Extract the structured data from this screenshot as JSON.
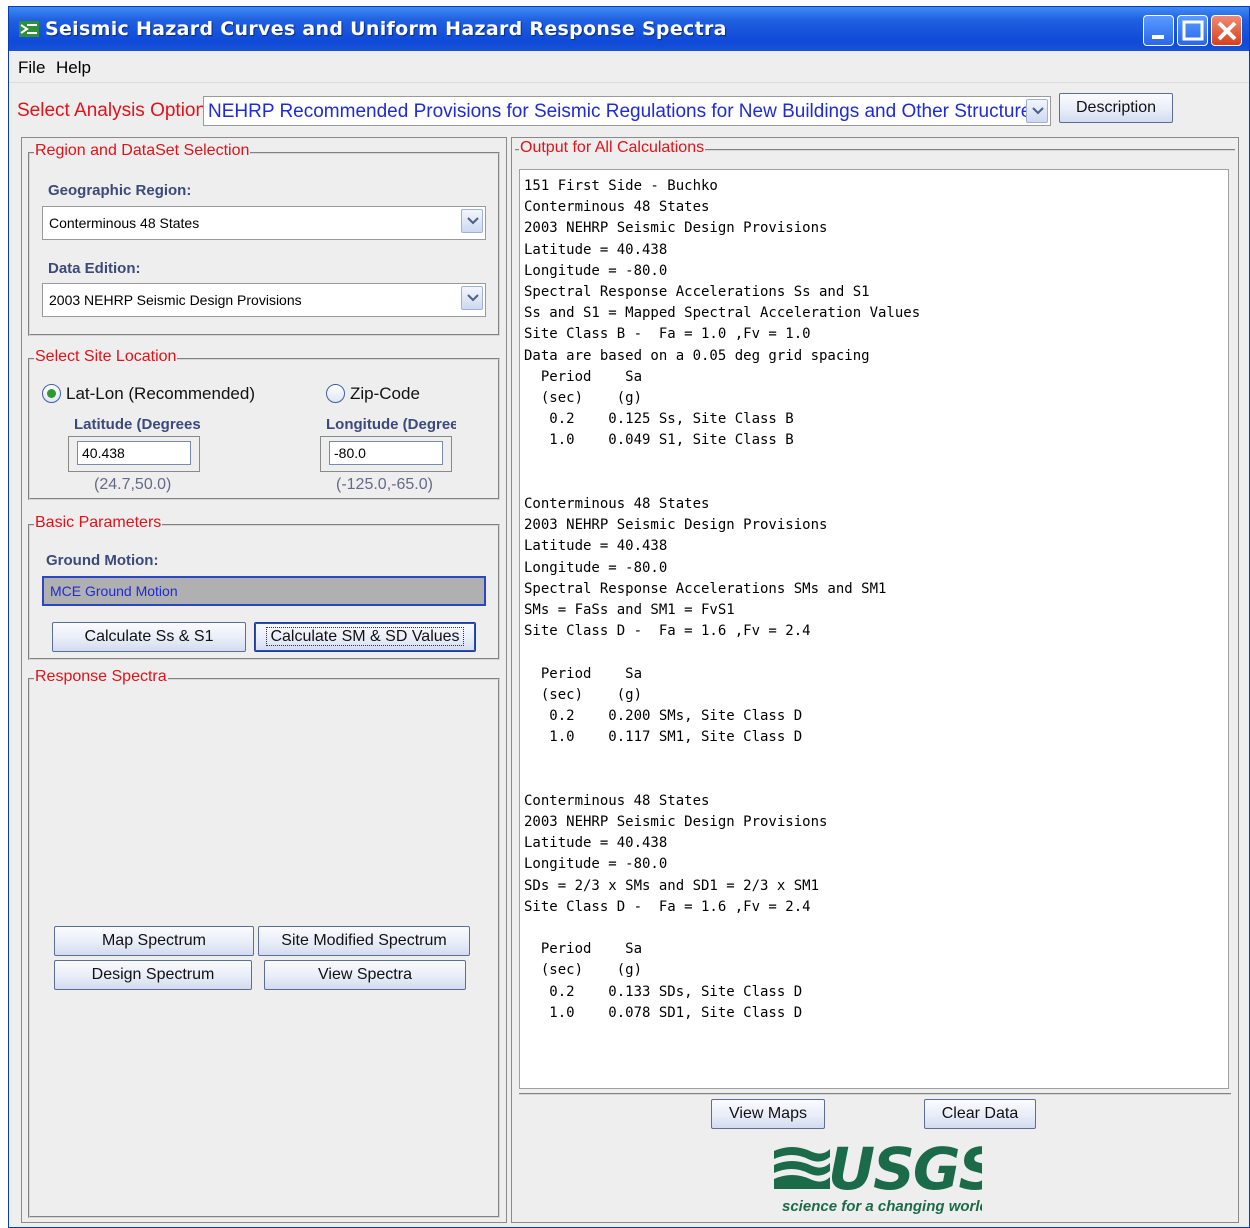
{
  "window": {
    "title": "Seismic Hazard Curves and Uniform Hazard Response Spectra",
    "accent": "#1f5fe0"
  },
  "menu": {
    "file": "File",
    "help": "Help"
  },
  "analysis": {
    "label": "Select Analysis Option:",
    "selected": "NEHRP Recommended Provisions for Seismic Regulations for New Buildings and Other Structures",
    "description_button": "Description"
  },
  "region": {
    "legend": "Region and DataSet Selection",
    "geo_label": "Geographic Region:",
    "geo_value": "Conterminous 48 States",
    "edition_label": "Data Edition:",
    "edition_value": "2003 NEHRP Seismic Design Provisions"
  },
  "site": {
    "legend": "Select Site Location",
    "latlon_label": "Lat-Lon (Recommended)",
    "zip_label": "Zip-Code",
    "selected": "latlon",
    "lat_label": "Latitude (Degrees",
    "lon_label": "Longitude (Degree",
    "lat_value": "40.438",
    "lon_value": "-80.0",
    "lat_range": "(24.7,50.0)",
    "lon_range": "(-125.0,-65.0)"
  },
  "basic": {
    "legend": "Basic Parameters",
    "motion_label": "Ground Motion:",
    "motion_value": "MCE Ground Motion",
    "calc_ss_button": "Calculate Ss & S1",
    "calc_sm_button": "Calculate SM & SD Values"
  },
  "spectra": {
    "legend": "Response Spectra",
    "map_button": "Map Spectrum",
    "site_modified_button": "Site Modified Spectrum",
    "design_button": "Design Spectrum",
    "view_button": "View Spectra"
  },
  "output": {
    "legend": "Output for All Calculations",
    "lines": [
      "151 First Side - Buchko",
      "Conterminous 48 States",
      "2003 NEHRP Seismic Design Provisions",
      "Latitude = 40.438",
      "Longitude = -80.0",
      "Spectral Response Accelerations Ss and S1",
      "Ss and S1 = Mapped Spectral Acceleration Values",
      "Site Class B -  Fa = 1.0 ,Fv = 1.0",
      "Data are based on a 0.05 deg grid spacing",
      "  Period    Sa",
      "  (sec)    (g)",
      "   0.2    0.125 Ss, Site Class B",
      "   1.0    0.049 S1, Site Class B",
      "",
      "",
      "Conterminous 48 States",
      "2003 NEHRP Seismic Design Provisions",
      "Latitude = 40.438",
      "Longitude = -80.0",
      "Spectral Response Accelerations SMs and SM1",
      "SMs = FaSs and SM1 = FvS1",
      "Site Class D -  Fa = 1.6 ,Fv = 2.4",
      "",
      "  Period    Sa",
      "  (sec)    (g)",
      "   0.2    0.200 SMs, Site Class D",
      "   1.0    0.117 SM1, Site Class D",
      "",
      "",
      "Conterminous 48 States",
      "2003 NEHRP Seismic Design Provisions",
      "Latitude = 40.438",
      "Longitude = -80.0",
      "SDs = 2/3 x SMs and SD1 = 2/3 x SM1",
      "Site Class D -  Fa = 1.6 ,Fv = 2.4",
      "",
      "  Period    Sa",
      "  (sec)    (g)",
      "   0.2    0.133 SDs, Site Class D",
      "   1.0    0.078 SD1, Site Class D"
    ],
    "view_maps_button": "View Maps",
    "clear_button": "Clear Data"
  },
  "logo": {
    "name": "USGS",
    "tagline": "science for a changing world",
    "color": "#1b6b4a"
  }
}
